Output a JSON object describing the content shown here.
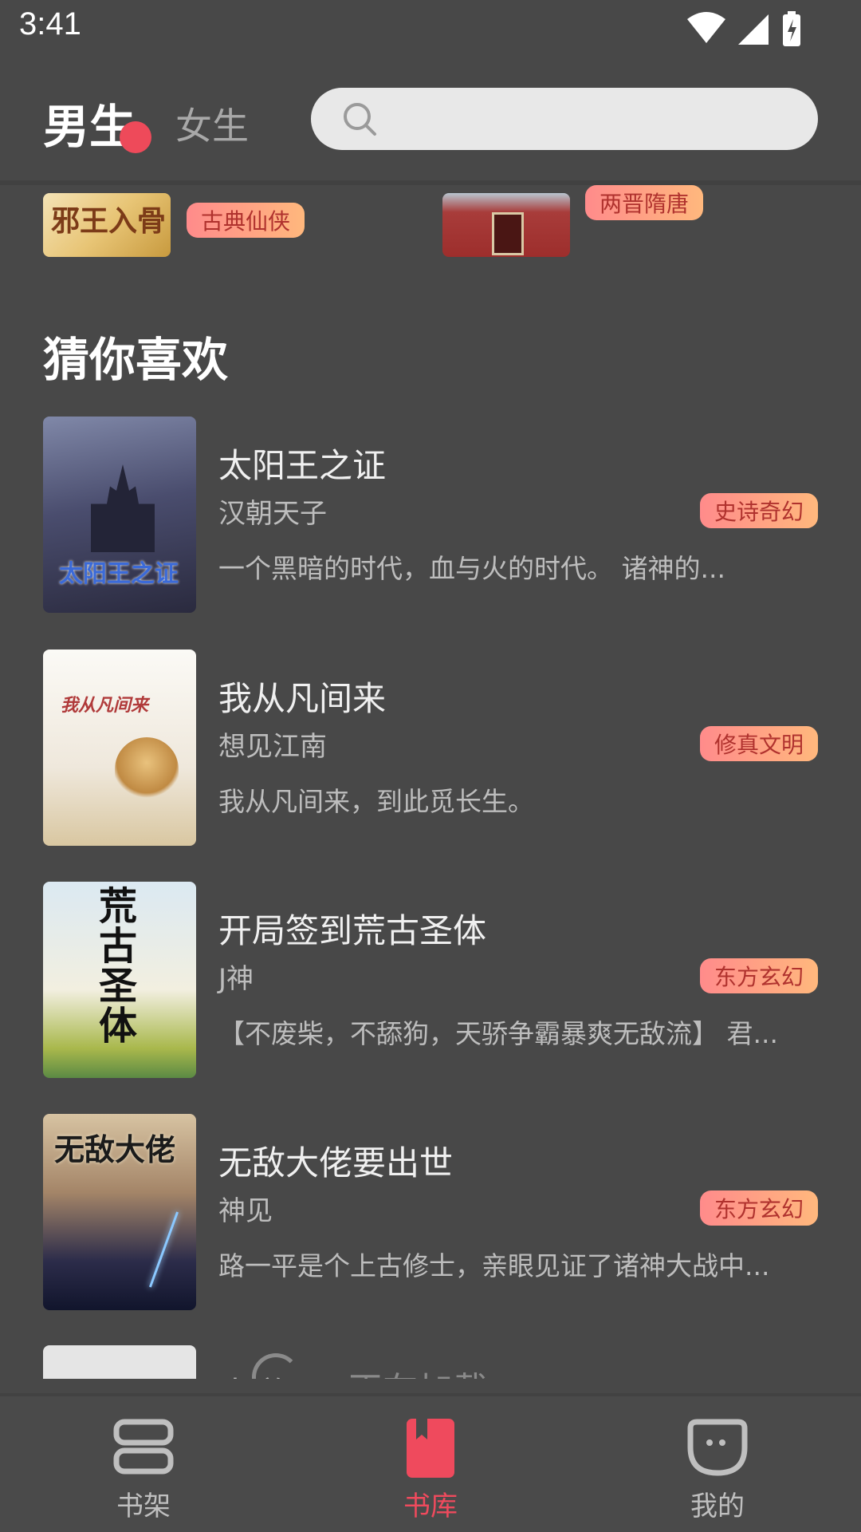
{
  "status_bar": {
    "time": "3:41"
  },
  "header": {
    "tabs": [
      {
        "label": "男生",
        "selected": true
      },
      {
        "label": "女生",
        "selected": false
      }
    ],
    "search": {
      "placeholder": ""
    }
  },
  "category_strip": {
    "items": [
      {
        "cover_text": "邪王入骨",
        "tag": "古典仙侠"
      },
      {
        "cover_text": "",
        "tag": "两晋隋唐"
      }
    ]
  },
  "recommend": {
    "title": "猜你喜欢",
    "books": [
      {
        "cover_text": "太阳王之证",
        "title": "太阳王之证",
        "author": "汉朝天子",
        "tag": "史诗奇幻",
        "desc": "一个黑暗的时代，血与火的时代。        诸神的..."
      },
      {
        "cover_text": "我从凡间来",
        "title": "我从凡间来",
        "author": "想见江南",
        "tag": "修真文明",
        "desc": "我从凡间来，到此觅长生。"
      },
      {
        "cover_text": "荒古圣体",
        "title": "开局签到荒古圣体",
        "author": "J神",
        "tag": "东方玄幻",
        "desc": "【不废柴，不舔狗，天骄争霸暴爽无敌流】 君..."
      },
      {
        "cover_text": "无敌大佬",
        "title": "无敌大佬要出世",
        "author": "神见",
        "tag": "东方玄幻",
        "desc": "路一平是个上古修士，亲眼见证了诸神大战中..."
      }
    ],
    "loading": {
      "partial_title": "人道",
      "text": "正在加载"
    }
  },
  "bottom_nav": {
    "items": [
      {
        "label": "书架",
        "icon": "bookshelf-icon",
        "active": false
      },
      {
        "label": "书库",
        "icon": "book-library-icon",
        "active": true
      },
      {
        "label": "我的",
        "icon": "profile-icon",
        "active": false
      }
    ]
  },
  "colors": {
    "background": "#484848",
    "accent": "#ef4a5d",
    "tag_gradient_start": "#ff8b8b",
    "tag_gradient_end": "#ffb87d"
  }
}
